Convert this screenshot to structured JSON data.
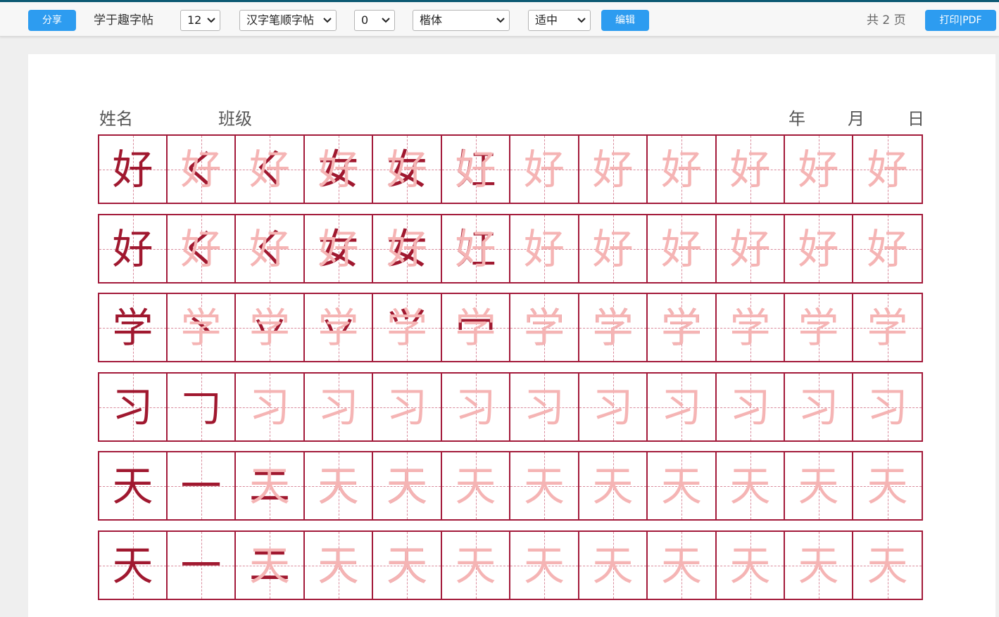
{
  "toolbar": {
    "share_label": "分享",
    "site_title": "学于趣字帖",
    "size_select": "12",
    "type_select": "汉字笔顺字帖",
    "count_select": "0",
    "font_select": "楷体",
    "fit_select": "适中",
    "edit_label": "编辑",
    "pages_text": "共 2 页",
    "print_label": "打印|PDF",
    "accent": "#2d9cf0",
    "top_border": "#0d5a73"
  },
  "sheet": {
    "name_label": "姓名",
    "class_label": "班级",
    "year_label": "年",
    "month_label": "月",
    "day_label": "日",
    "grid_color": "#a31a3a",
    "dark_ink": "#a0182f",
    "light_ink": "#f5b4b4",
    "rows": [
      {
        "char": "好",
        "strokes": [
          "く",
          "ㄑ",
          "女",
          "女",
          "妅",
          "好"
        ],
        "dark_cells": 6
      },
      {
        "char": "好",
        "strokes": [
          "く",
          "ㄑ",
          "女",
          "女",
          "妅",
          "好"
        ],
        "dark_cells": 6
      },
      {
        "char": "学",
        "strokes": [
          "丶",
          "丷",
          "丷",
          "⺍",
          "冖",
          "学",
          "学",
          "学"
        ],
        "dark_cells": 9
      },
      {
        "char": "习",
        "strokes": [
          "𠃌",
          "习",
          "习"
        ],
        "dark_cells": 2
      },
      {
        "char": "天",
        "strokes": [
          "一",
          "二",
          "天",
          "天"
        ],
        "dark_cells": 5
      },
      {
        "char": "天",
        "strokes": [
          "一",
          "二",
          "天",
          "天"
        ],
        "dark_cells": 5
      }
    ],
    "cells_per_row": 12
  }
}
